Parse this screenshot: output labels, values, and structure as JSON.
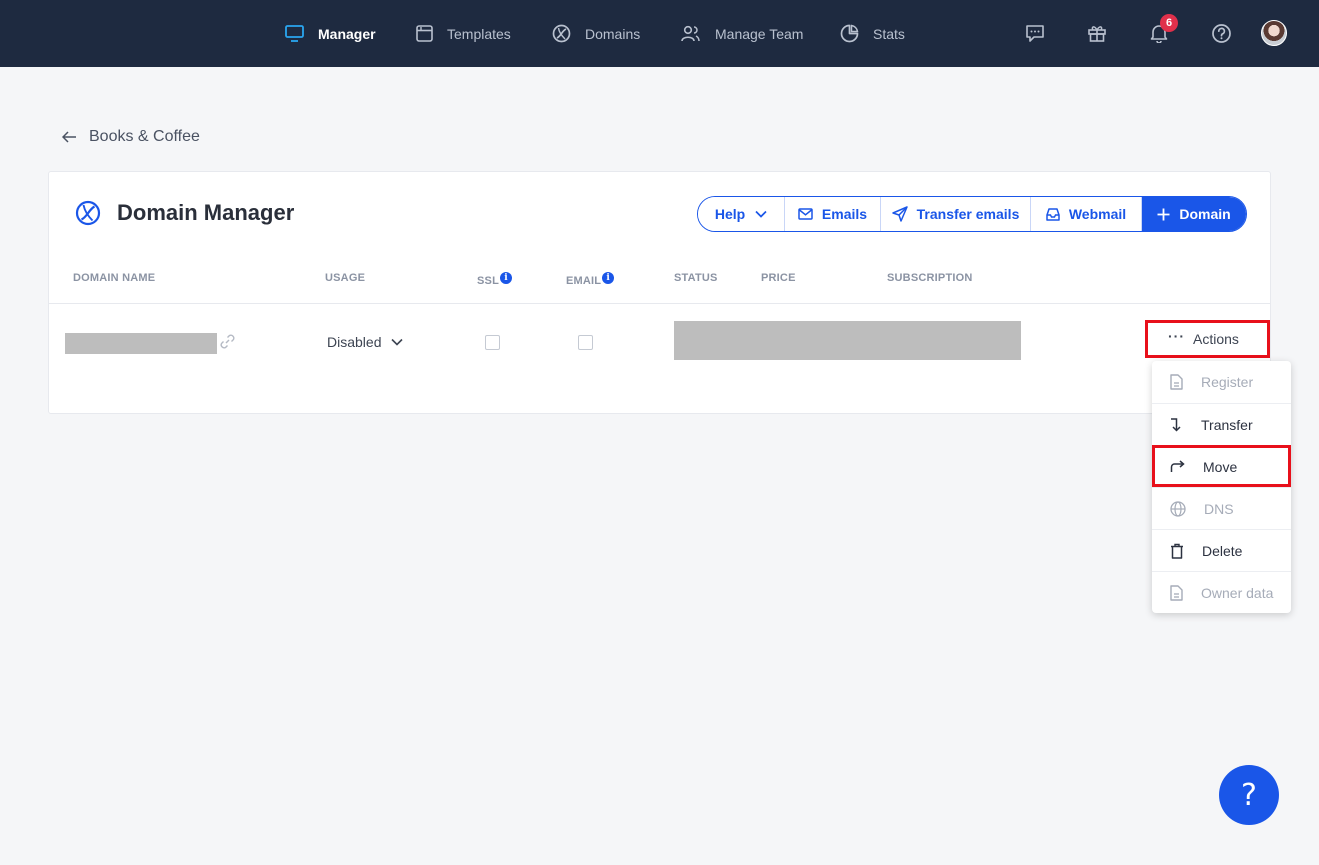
{
  "nav": {
    "items": [
      {
        "label": "Manager",
        "icon": "monitor-icon",
        "active": true
      },
      {
        "label": "Templates",
        "icon": "template-icon",
        "active": false
      },
      {
        "label": "Domains",
        "icon": "domains-icon",
        "active": false
      },
      {
        "label": "Manage Team",
        "icon": "team-icon",
        "active": false
      },
      {
        "label": "Stats",
        "icon": "pie-chart-icon",
        "active": false
      }
    ],
    "notifications_count": "6",
    "icons": [
      "chat-icon",
      "gift-icon",
      "bell-icon",
      "help-circle-icon",
      "avatar"
    ]
  },
  "breadcrumb": {
    "label": "Books & Coffee"
  },
  "card": {
    "title": "Domain Manager",
    "buttons": {
      "help": "Help",
      "emails": "Emails",
      "transfer_emails": "Transfer emails",
      "webmail": "Webmail",
      "add_domain": "Domain"
    },
    "columns": {
      "domain_name": "DOMAIN NAME",
      "usage": "USAGE",
      "ssl": "SSL",
      "email": "EMAIL",
      "status": "STATUS",
      "price": "PRICE",
      "subscription": "SUBSCRIPTION"
    },
    "info_glyph": "i",
    "row": {
      "usage": "Disabled",
      "ssl_checked": false,
      "email_checked": false,
      "actions_label": "Actions",
      "actions_dots": "···"
    }
  },
  "menu": {
    "items": [
      {
        "label": "Register",
        "icon": "document-icon",
        "disabled": true
      },
      {
        "label": "Transfer",
        "icon": "transfer-arrow-icon",
        "disabled": false
      },
      {
        "label": "Move",
        "icon": "move-arrow-icon",
        "disabled": false,
        "highlighted": true
      },
      {
        "label": "DNS",
        "icon": "globe-icon",
        "disabled": true
      },
      {
        "label": "Delete",
        "icon": "trash-icon",
        "disabled": false
      },
      {
        "label": "Owner data",
        "icon": "document-icon",
        "disabled": true
      }
    ]
  },
  "help_fab": {
    "label": "?"
  },
  "colors": {
    "nav_bg": "#1e2a40",
    "accent": "#1a56e8",
    "highlight": "#e8101b",
    "badge": "#e0304b",
    "page_bg": "#f5f6f8"
  }
}
